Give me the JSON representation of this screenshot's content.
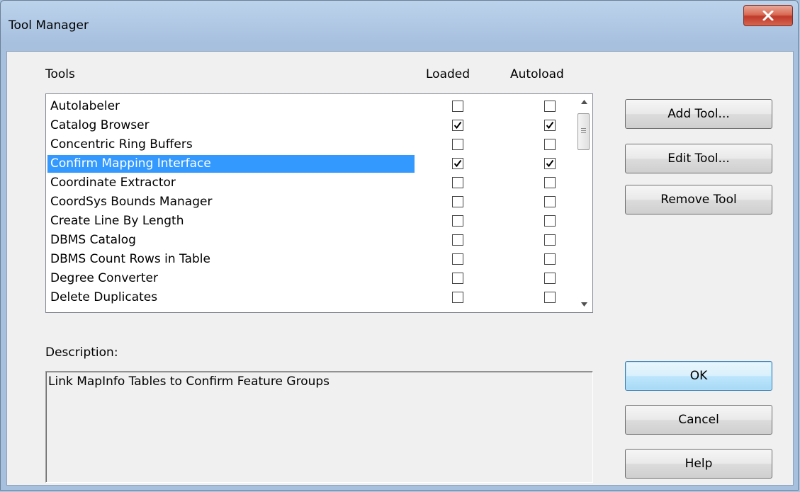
{
  "window": {
    "title": "Tool Manager"
  },
  "headers": {
    "tools": "Tools",
    "loaded": "Loaded",
    "autoload": "Autoload"
  },
  "tools": [
    {
      "name": "Autolabeler",
      "loaded": false,
      "autoload": false,
      "selected": false
    },
    {
      "name": "Catalog Browser",
      "loaded": true,
      "autoload": true,
      "selected": false
    },
    {
      "name": "Concentric Ring Buffers",
      "loaded": false,
      "autoload": false,
      "selected": false
    },
    {
      "name": "Confirm Mapping Interface",
      "loaded": true,
      "autoload": true,
      "selected": true
    },
    {
      "name": "Coordinate Extractor",
      "loaded": false,
      "autoload": false,
      "selected": false
    },
    {
      "name": "CoordSys Bounds Manager",
      "loaded": false,
      "autoload": false,
      "selected": false
    },
    {
      "name": "Create Line By Length",
      "loaded": false,
      "autoload": false,
      "selected": false
    },
    {
      "name": "DBMS Catalog",
      "loaded": false,
      "autoload": false,
      "selected": false
    },
    {
      "name": "DBMS Count Rows in Table",
      "loaded": false,
      "autoload": false,
      "selected": false
    },
    {
      "name": "Degree Converter",
      "loaded": false,
      "autoload": false,
      "selected": false
    },
    {
      "name": "Delete Duplicates",
      "loaded": false,
      "autoload": false,
      "selected": false
    }
  ],
  "buttons": {
    "add": "Add Tool...",
    "edit": "Edit Tool...",
    "remove": "Remove Tool",
    "ok": "OK",
    "cancel": "Cancel",
    "help": "Help"
  },
  "description": {
    "label": "Description:",
    "text": "Link MapInfo Tables to Confirm Feature Groups"
  },
  "colors": {
    "selection": "#3399ff",
    "close_button": "#c0392b"
  },
  "icons": {
    "close": "close-icon",
    "scroll_up": "scroll-up-arrow-icon",
    "scroll_down": "scroll-down-arrow-icon",
    "check": "checkmark-icon"
  }
}
